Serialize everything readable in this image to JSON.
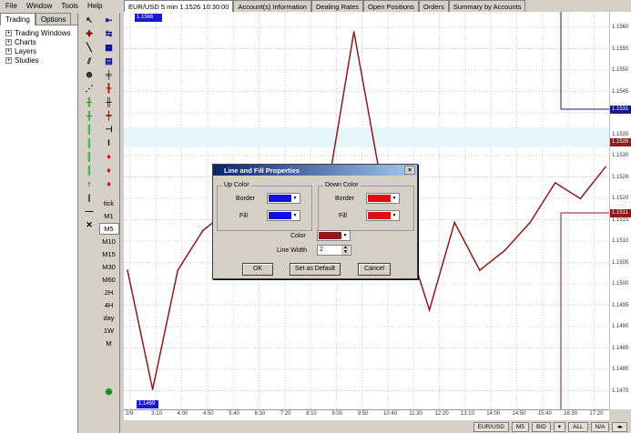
{
  "menu": [
    "File",
    "Window",
    "Tools",
    "Help"
  ],
  "left_panel": {
    "tabs": [
      "Trading",
      "Options"
    ],
    "tree": [
      "Trading Windows",
      "Charts",
      "Layers",
      "Studies"
    ]
  },
  "tabs": [
    "EUR/USD 5 min 1.1526 10:30:00",
    "Account(s) Information",
    "Dealing Rates",
    "Open Positions",
    "Orders",
    "Summary by Accounts"
  ],
  "timeframes": [
    "tick",
    "M1",
    "M5",
    "M10",
    "M15",
    "M30",
    "M60",
    "2H",
    "4H",
    "day",
    "1W",
    "M"
  ],
  "selected_timeframe": "M5",
  "price_labels": [
    "1.1560",
    "1.1555",
    "1.1550",
    "1.1545",
    "1.1540",
    "1.1535",
    "1.1530",
    "1.1526",
    "1.1520",
    "1.1515",
    "1.1510",
    "1.1505",
    "1.1500",
    "1.1495",
    "1.1490",
    "1.1485",
    "1.1480",
    "1.1475"
  ],
  "price_tags": {
    "top": "1.1531",
    "current": "1.1526",
    "bottom": "1.1511"
  },
  "chart_tags": {
    "top_left": "1.1566",
    "bottom_left": "1.1469"
  },
  "time_labels": [
    "2/9",
    "3:10",
    "4:00",
    "4:50",
    "5:40",
    "6:30",
    "7:20",
    "8:10",
    "9:00",
    "9:50",
    "10:40",
    "11:30",
    "12:20",
    "13:10",
    "14:00",
    "14:50",
    "15:40",
    "16:30",
    "17:20"
  ],
  "status_buttons": [
    "EUR/USD",
    "M5",
    "BID",
    "ALL",
    "N/A"
  ],
  "dialog": {
    "title": "Line and Fill Properties",
    "up_group": "Up Color",
    "down_group": "Down Color",
    "border_label": "Border",
    "fill_label": "Fill",
    "color_label": "Color",
    "line_width_label": "Line Width",
    "line_width_value": "2",
    "ok": "OK",
    "set_default": "Set as Default",
    "cancel": "Cancel",
    "colors": {
      "up_border": "#1010e0",
      "up_fill": "#1010e0",
      "down_border": "#e01010",
      "down_fill": "#e01010",
      "line": "#8b1a1a"
    }
  },
  "chart_data": {
    "type": "line",
    "x": [
      "2/9",
      "3:10",
      "4:00",
      "4:50",
      "5:40",
      "6:30",
      "7:20",
      "8:10",
      "9:00",
      "9:50",
      "10:40",
      "11:30",
      "12:20",
      "13:10",
      "14:00",
      "14:50",
      "15:40",
      "16:30",
      "17:20",
      "10:30"
    ],
    "y": [
      1.15,
      1.147,
      1.15,
      1.151,
      1.1515,
      1.1505,
      1.152,
      1.151,
      1.1522,
      1.156,
      1.1525,
      1.151,
      1.149,
      1.1512,
      1.15,
      1.1505,
      1.1512,
      1.1522,
      1.1518,
      1.1526
    ],
    "ylim": [
      1.1465,
      1.1565
    ],
    "line_color": "#8b1a1a"
  }
}
